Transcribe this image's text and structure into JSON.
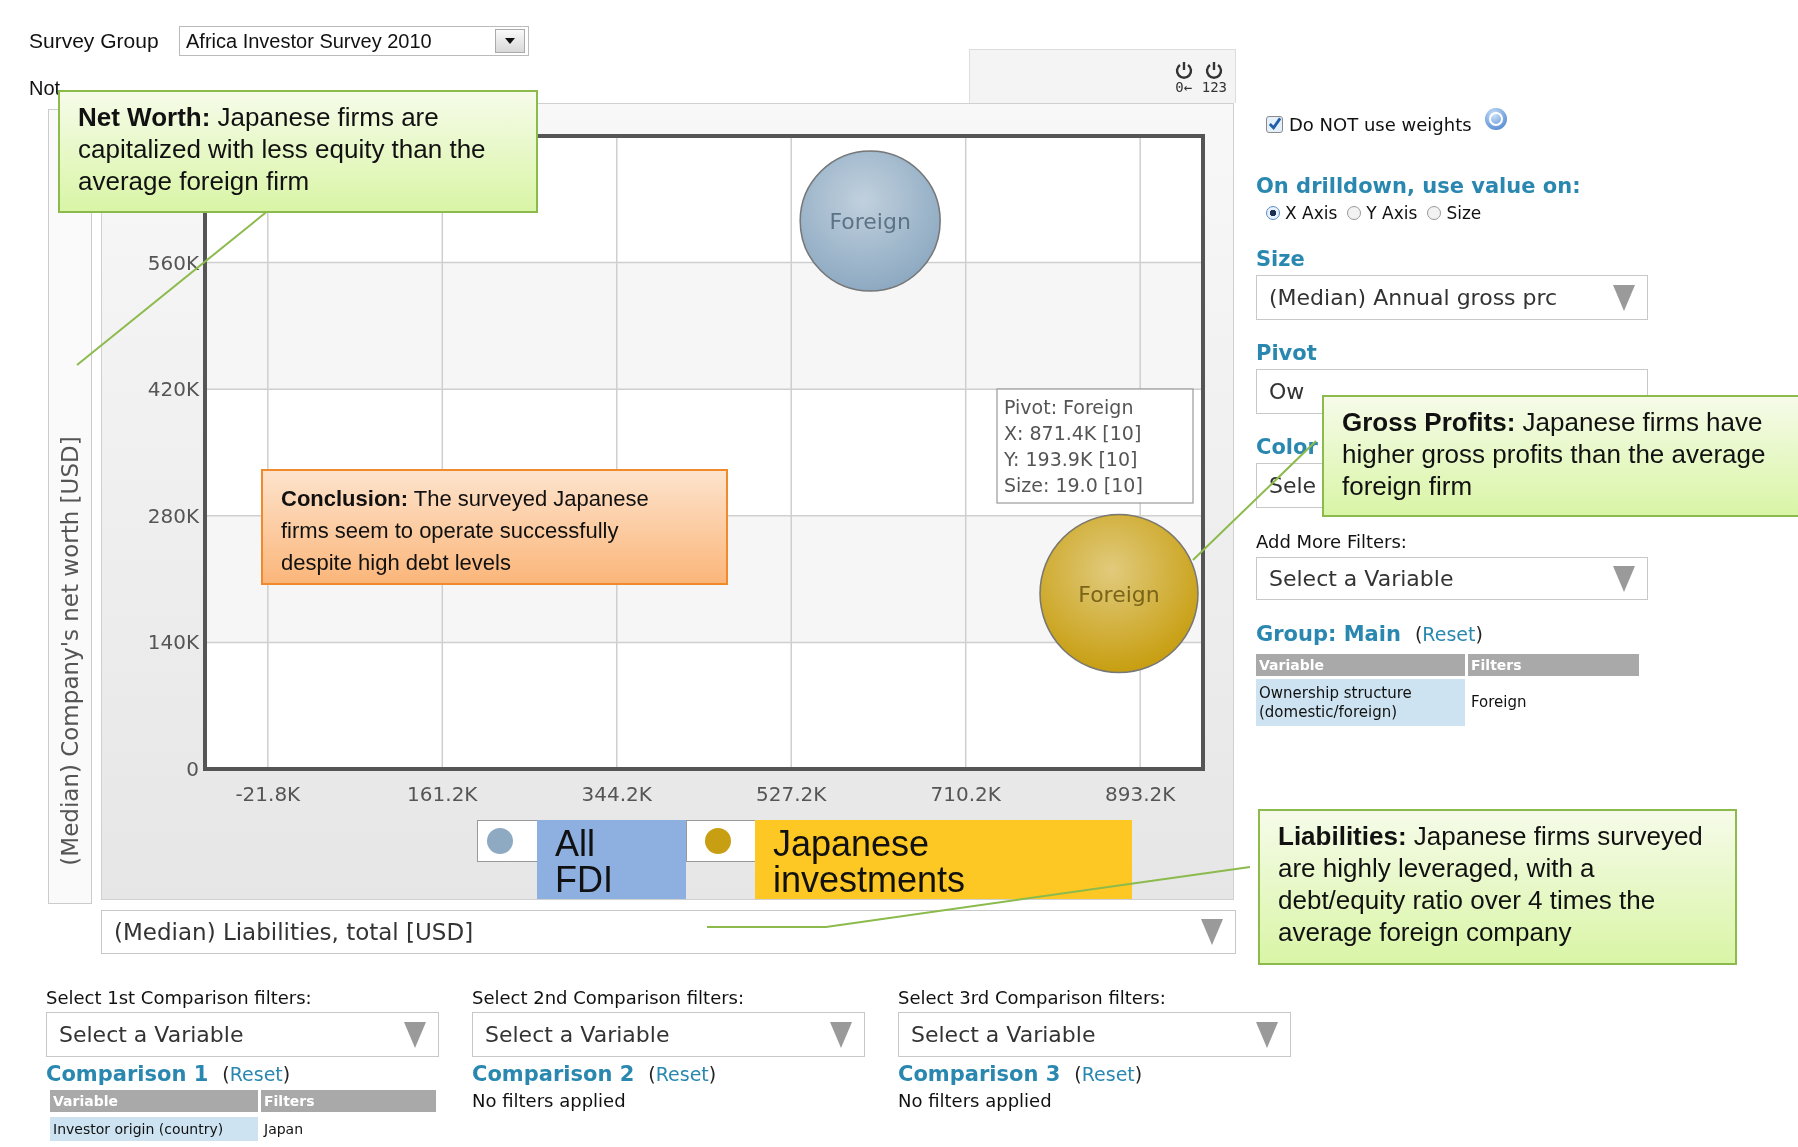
{
  "survey_group": {
    "label": "Survey Group",
    "value": "Africa Investor Survey 2010"
  },
  "note": "Not",
  "toolbar": [
    {
      "label": "0←"
    },
    {
      "label": "123"
    }
  ],
  "chart": {
    "tooltip": [
      "Pivot: Foreign",
      "X: 871.4K [10]",
      "Y: 193.9K [10]",
      "Size: 19.0 [10]"
    ],
    "chart_data": {
      "type": "scatter",
      "ylabel": "(Median) Company's net worth [USD]",
      "xlabel": "(Median) Liabilities, total [USD]",
      "x": [
        610000,
        871000
      ],
      "series": [
        {
          "name": "All FDI",
          "color": "#8eaac2",
          "values": [
            606000,
            null
          ]
        },
        {
          "name": "Japanese investments",
          "color": "#c89f12",
          "values": [
            null,
            194000
          ]
        }
      ],
      "xlim": [
        -87700,
        959100
      ],
      "ylim": [
        0,
        700000
      ],
      "grid": true,
      "xticks": [
        {
          "value": -21800,
          "label": "-21.8K"
        },
        {
          "value": 161200,
          "label": "161.2K"
        },
        {
          "value": 344200,
          "label": "344.2K"
        },
        {
          "value": 527200,
          "label": "527.2K"
        },
        {
          "value": 710200,
          "label": "710.2K"
        },
        {
          "value": 893200,
          "label": "893.2K"
        }
      ],
      "yticks": [
        {
          "value": 0,
          "label": "0"
        },
        {
          "value": 140000,
          "label": "140K"
        },
        {
          "value": 280000,
          "label": "280K"
        },
        {
          "value": 420000,
          "label": "420K"
        },
        {
          "value": 560000,
          "label": "560K"
        }
      ],
      "annotations": [
        {
          "x": 610000,
          "y": 606000,
          "text": "Foreign"
        },
        {
          "x": 871000,
          "y": 194000,
          "text": "Foreign"
        }
      ]
    }
  },
  "weights": {
    "label": "Do NOT use weights",
    "checked": true
  },
  "drilldown": {
    "title": "On drilldown, use value on:",
    "options": [
      {
        "label": "X Axis",
        "selected": true
      },
      {
        "label": "Y Axis",
        "selected": false
      },
      {
        "label": "Size",
        "selected": false
      }
    ]
  },
  "selectors": [
    {
      "title": "Size",
      "value": "(Median) Annual gross prc"
    },
    {
      "title": "Pivot",
      "value": "Ow"
    },
    {
      "title": "Color",
      "value": "Sele"
    }
  ],
  "add_filters": {
    "label": "Add More Filters:",
    "value": "Select a Variable"
  },
  "group": {
    "title": "Group: Main",
    "reset": "(Reset)",
    "columns": [
      "Variable",
      "Filters"
    ],
    "rows": [
      [
        "Ownership structure (domestic/foreign)",
        "Foreign"
      ]
    ]
  },
  "comparisons": [
    {
      "label": "Select 1st Comparison filters:",
      "value": "Select a Variable",
      "title": "Comparison 1",
      "reset": "(Reset)",
      "columns": [
        "Variable",
        "Filters"
      ],
      "rows": [
        [
          "Investor origin (country)",
          "Japan"
        ]
      ]
    },
    {
      "label": "Select 2nd Comparison filters:",
      "value": "Select a Variable",
      "title": "Comparison 2",
      "reset": "(Reset)",
      "empty_text": "No filters applied"
    },
    {
      "label": "Select 3rd Comparison filters:",
      "value": "Select a Variable",
      "title": "Comparison 3",
      "reset": "(Reset)",
      "empty_text": "No filters applied"
    }
  ],
  "callouts": [
    {
      "kind": "note",
      "text": "**Net Worth:** Japanese firms are capitalized with less equity than the average foreign firm"
    },
    {
      "kind": "conclusion",
      "text": "**Conclusion:** The surveyed Japanese firms seem to operate successfully despite high debt levels"
    },
    {
      "kind": "note",
      "text": "**Gross Profits:** Japanese firms have higher gross profits than the average foreign firm"
    },
    {
      "kind": "note",
      "text": "**Liabilities:** Japanese firms surveyed are highly leveraged, with a debt/equity ratio over 4 times the average foreign company"
    }
  ]
}
